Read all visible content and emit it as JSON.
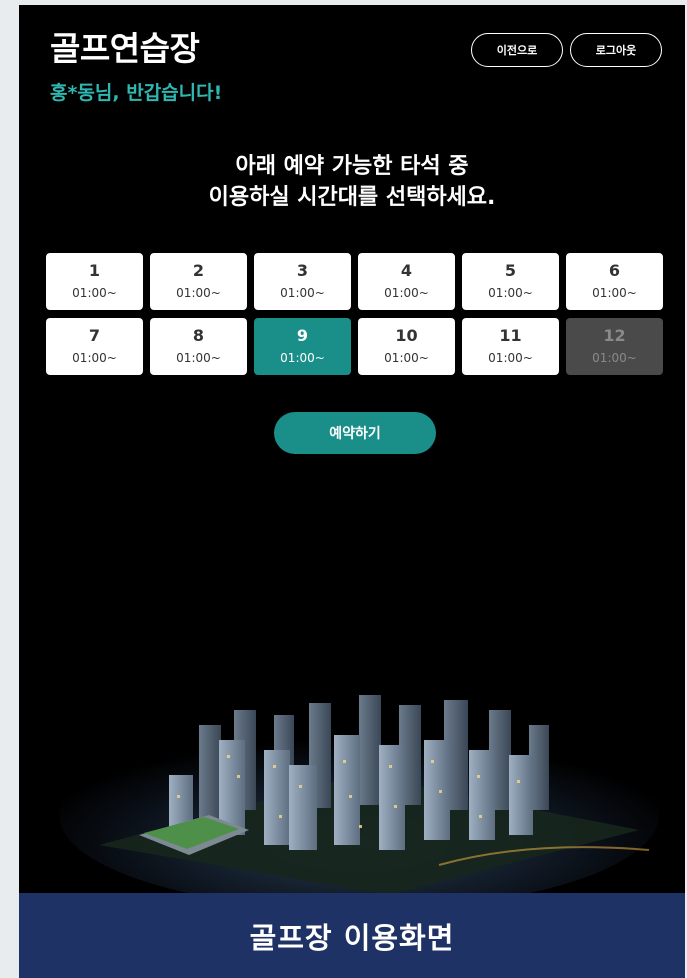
{
  "header": {
    "title": "골프연습장",
    "greeting": "홍*동님, 반갑습니다!",
    "prev_label": "이전으로",
    "logout_label": "로그아웃"
  },
  "instruction": {
    "line1": "아래 예약 가능한 타석 중",
    "line2": "이용하실 시간대를 선택하세요."
  },
  "slots": [
    {
      "num": "1",
      "time": "01:00~",
      "state": "available"
    },
    {
      "num": "2",
      "time": "01:00~",
      "state": "available"
    },
    {
      "num": "3",
      "time": "01:00~",
      "state": "available"
    },
    {
      "num": "4",
      "time": "01:00~",
      "state": "available"
    },
    {
      "num": "5",
      "time": "01:00~",
      "state": "available"
    },
    {
      "num": "6",
      "time": "01:00~",
      "state": "available"
    },
    {
      "num": "7",
      "time": "01:00~",
      "state": "available"
    },
    {
      "num": "8",
      "time": "01:00~",
      "state": "available"
    },
    {
      "num": "9",
      "time": "01:00~",
      "state": "selected"
    },
    {
      "num": "10",
      "time": "01:00~",
      "state": "available"
    },
    {
      "num": "11",
      "time": "01:00~",
      "state": "available"
    },
    {
      "num": "12",
      "time": "01:00~",
      "state": "disabled"
    }
  ],
  "reserve_label": "예약하기",
  "footer": {
    "label": "골프장 이용화면"
  },
  "colors": {
    "accent": "#1a8f8a",
    "greeting": "#2fb7b0",
    "footer_bg": "#1e3266",
    "disabled_bg": "#4a4a4a"
  },
  "illustration": "night-apartment-complex"
}
